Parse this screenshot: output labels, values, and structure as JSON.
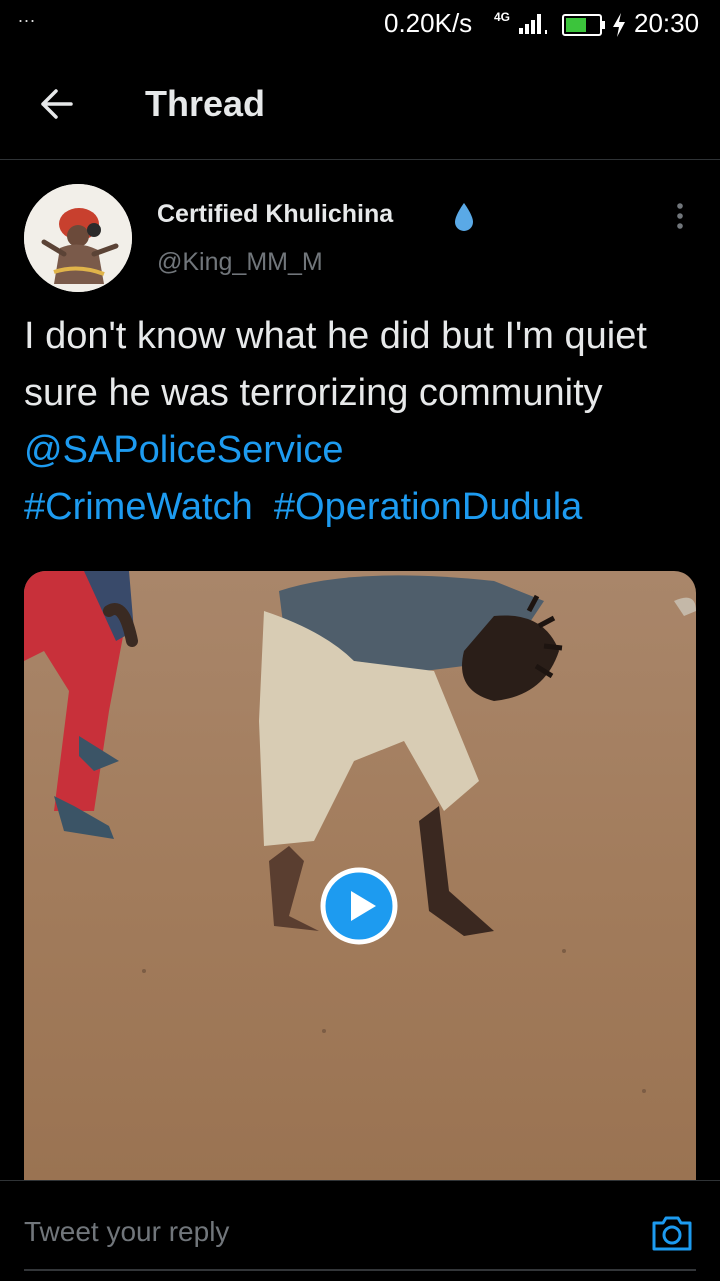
{
  "status_bar": {
    "dots": "...",
    "net_speed": "0.20K/s",
    "network_type": "4G",
    "time": "20:30",
    "battery_color": "#3cc43c"
  },
  "header": {
    "title": "Thread",
    "back_icon": "arrow-left-icon"
  },
  "tweet": {
    "author_name": "Certified Khulichina",
    "author_badge_icon": "water-drop-icon",
    "handle": "@King_MM_M",
    "more_icon": "vertical-dots-icon",
    "text_plain": "I don't know what he did but I'm quiet sure he was terrorizing community ",
    "mention": "@SAPoliceService",
    "hashtags": [
      "#CrimeWatch",
      "#OperationDudula"
    ],
    "media_type": "video",
    "play_icon": "play-icon"
  },
  "reply_bar": {
    "placeholder": "Tweet your reply",
    "camera_icon": "camera-icon"
  },
  "colors": {
    "background": "#000000",
    "text": "#e7e9ea",
    "secondary_text": "#71767b",
    "accent": "#1d9bf0",
    "divider": "#2f3336"
  }
}
